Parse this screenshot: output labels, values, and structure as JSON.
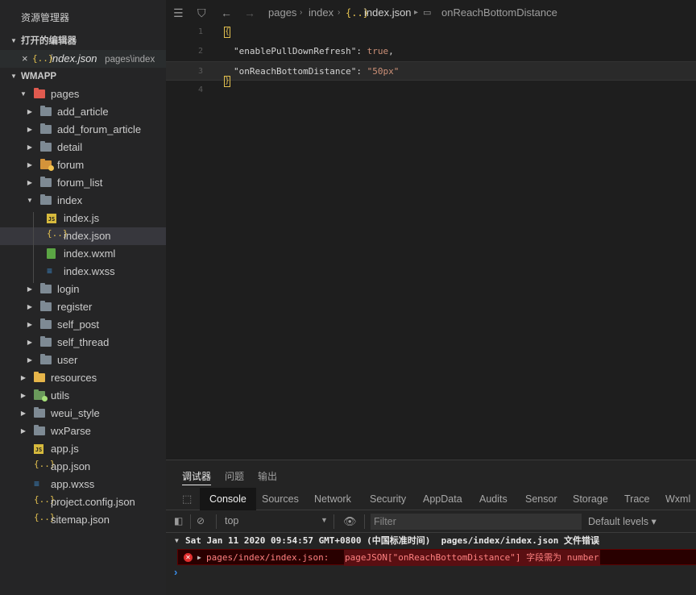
{
  "sidebar": {
    "title": "资源管理器",
    "open_editors": {
      "label": "打开的编辑器",
      "file": {
        "name": "index.json",
        "path": "pages\\index"
      }
    },
    "project": {
      "label": "WMAPP",
      "tree": [
        {
          "label": "pages",
          "kind": "folder-red",
          "depth": 1,
          "expanded": true
        },
        {
          "label": "add_article",
          "kind": "folder",
          "depth": 2
        },
        {
          "label": "add_forum_article",
          "kind": "folder",
          "depth": 2
        },
        {
          "label": "detail",
          "kind": "folder",
          "depth": 2
        },
        {
          "label": "forum",
          "kind": "folder-orange",
          "depth": 2
        },
        {
          "label": "forum_list",
          "kind": "folder",
          "depth": 2
        },
        {
          "label": "index",
          "kind": "folder",
          "depth": 2,
          "expanded": true
        },
        {
          "label": "index.js",
          "kind": "js",
          "depth": 3
        },
        {
          "label": "index.json",
          "kind": "json",
          "depth": 3,
          "selected": true
        },
        {
          "label": "index.wxml",
          "kind": "wxml",
          "depth": 3
        },
        {
          "label": "index.wxss",
          "kind": "wxss",
          "depth": 3
        },
        {
          "label": "login",
          "kind": "folder",
          "depth": 2
        },
        {
          "label": "register",
          "kind": "folder",
          "depth": 2
        },
        {
          "label": "self_post",
          "kind": "folder",
          "depth": 2
        },
        {
          "label": "self_thread",
          "kind": "folder",
          "depth": 2
        },
        {
          "label": "user",
          "kind": "folder",
          "depth": 2
        },
        {
          "label": "resources",
          "kind": "folder-yellow",
          "depth": 1
        },
        {
          "label": "utils",
          "kind": "folder-green",
          "depth": 1
        },
        {
          "label": "weui_style",
          "kind": "folder",
          "depth": 1
        },
        {
          "label": "wxParse",
          "kind": "folder",
          "depth": 1
        },
        {
          "label": "app.js",
          "kind": "js",
          "depth": 1,
          "file": true
        },
        {
          "label": "app.json",
          "kind": "json",
          "depth": 1,
          "file": true
        },
        {
          "label": "app.wxss",
          "kind": "wxss",
          "depth": 1,
          "file": true
        },
        {
          "label": "project.config.json",
          "kind": "json",
          "depth": 1,
          "file": true
        },
        {
          "label": "sitemap.json",
          "kind": "json",
          "depth": 1,
          "file": true
        }
      ]
    }
  },
  "editor": {
    "breadcrumb": {
      "folder1": "pages",
      "folder2": "index",
      "file": "index.json",
      "symbol": "onReachBottomDistance"
    },
    "lines": [
      {
        "num": "1",
        "open": "{"
      },
      {
        "num": "2",
        "key": "\"enablePullDownRefresh\"",
        "colon": ": ",
        "value": "true",
        "tail": ","
      },
      {
        "num": "3",
        "key": "\"onReachBottomDistance\"",
        "colon": ": ",
        "value": "\"50px\"",
        "tail": ""
      },
      {
        "num": "4",
        "close": "}"
      }
    ]
  },
  "panel": {
    "tabs": [
      "调试器",
      "问题",
      "输出"
    ],
    "devtools_tabs": [
      "Console",
      "Sources",
      "Network",
      "Security",
      "AppData",
      "Audits",
      "Sensor",
      "Storage",
      "Trace",
      "Wxml"
    ],
    "context": "top",
    "filter_placeholder": "Filter",
    "levels": "Default levels",
    "log_group": "Sat Jan 11 2020 09:54:57 GMT+0800 (中国标准时间)  pages/index/index.json 文件错误",
    "error": {
      "path": "pages/index/index.json:",
      "message": "pageJSON[\"onReachBottomDistance\"] 字段需为 number"
    },
    "prompt": "›"
  },
  "colors": {
    "accent": "#3b8eea",
    "error_bg": "#290000",
    "error_text": "#ff8080"
  }
}
